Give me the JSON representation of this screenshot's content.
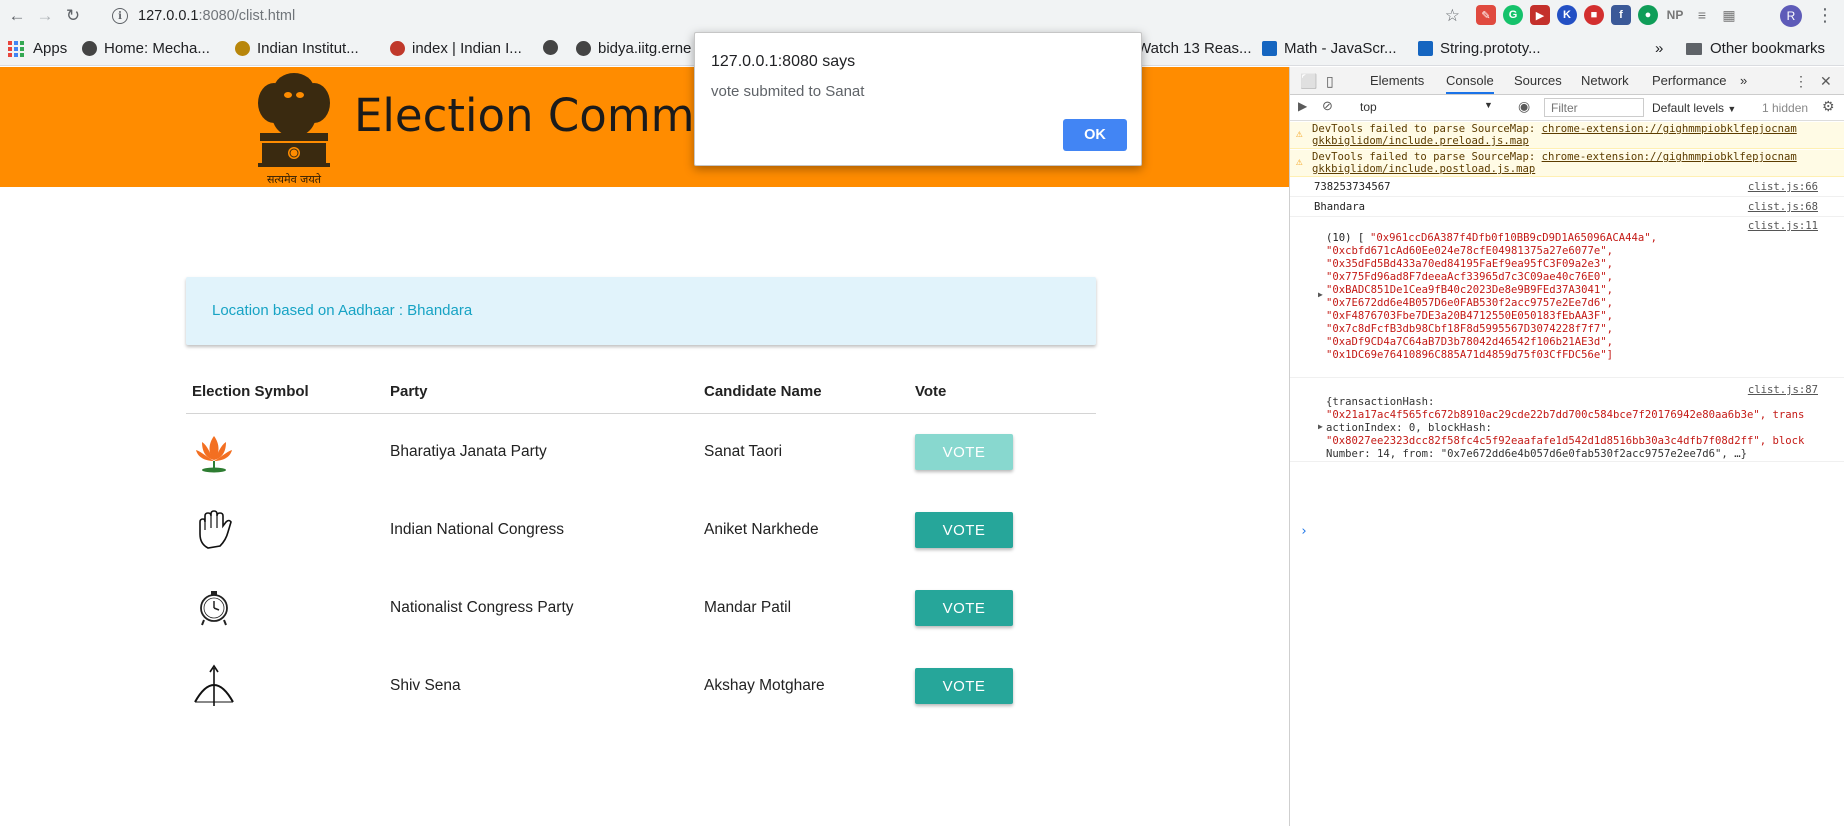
{
  "browser": {
    "url_host": "127.0.0.1",
    "url_path": ":8080/clist.html",
    "profile_initial": "R",
    "extensions": [
      "NP"
    ],
    "bookmarks": [
      {
        "label": "Apps"
      },
      {
        "label": "Home: Mecha..."
      },
      {
        "label": "Indian Institut..."
      },
      {
        "label": "index | Indian I..."
      },
      {
        "label": "bidya.iitg.erne"
      },
      {
        "label": "Watch 13 Reas..."
      },
      {
        "label": "Math - JavaScr..."
      },
      {
        "label": "String.prototy..."
      }
    ],
    "overflow_label": "»",
    "other_bookmarks": "Other bookmarks"
  },
  "header": {
    "title": "Election Commission of India",
    "motto": "सत्यमेव जयते"
  },
  "location": {
    "text": "Location based on Aadhaar : Bhandara"
  },
  "table": {
    "headers": [
      "Election Symbol",
      "Party",
      "Candidate Name",
      "Vote"
    ],
    "rows": [
      {
        "symbol": "lotus-icon",
        "party": "Bharatiya Janata Party",
        "candidate": "Sanat Taori",
        "vote": "VOTE"
      },
      {
        "symbol": "hand-icon",
        "party": "Indian National Congress",
        "candidate": "Aniket Narkhede",
        "vote": "VOTE"
      },
      {
        "symbol": "clock-icon",
        "party": "Nationalist Congress Party",
        "candidate": "Mandar Patil",
        "vote": "VOTE"
      },
      {
        "symbol": "bow-arrow-icon",
        "party": "Shiv Sena",
        "candidate": "Akshay Motghare",
        "vote": "VOTE"
      }
    ]
  },
  "alert": {
    "title": "127.0.0.1:8080 says",
    "message": "vote submited to Sanat",
    "ok": "OK"
  },
  "devtools": {
    "tabs": [
      "Elements",
      "Console",
      "Sources",
      "Network",
      "Performance"
    ],
    "more": "»",
    "context": "top",
    "filter_placeholder": "Filter",
    "levels": "Default levels",
    "hidden": "1 hidden",
    "warnings": [
      {
        "text": "DevTools failed to parse SourceMap: ",
        "link1": "chrome-extension://gighmmpiobklfepjocnam",
        "link2": "gkkbiglidom/include.preload.js.map"
      },
      {
        "text": "DevTools failed to parse SourceMap: ",
        "link1": "chrome-extension://gighmmpiobklfepjocnam",
        "link2": "gkkbiglidom/include.postload.js.map"
      }
    ],
    "logs": [
      {
        "text": "738253734567",
        "src": "clist.js:66"
      },
      {
        "text": "Bhandara",
        "src": "clist.js:68"
      }
    ],
    "array_log": {
      "src": "clist.js:11",
      "prefix": "(10) [",
      "items": [
        "\"0x961ccD6A387f4Dfb0f10BB9cD9D1A65096ACA44a\",",
        "\"0xcbfd671cAd60Ee024e78cfE04981375a27e6077e\",",
        "\"0x35dFd5Bd433a70ed84195FaEf9ea95fC3F09a2e3\",",
        "\"0x775Fd96ad8F7deeaAcf33965d7c3C09ae40c76E0\",",
        "\"0xBADC851De1Cea9fB40c2023De8e9B9FEd37A3041\",",
        "\"0x7E672dd6e4B057D6e0FAB530f2acc9757e2Ee7d6\",",
        "\"0xF4876703Fbe7DE3a20B4712550E050183fEbAA3F\",",
        "\"0x7c8dFcfB3db98Cbf18F8d5995567D3074228f7f7\",",
        "\"0xaDf9CD4a7C64aB7D3b78042d46542f106b21AE3d\",",
        "\"0x1DC69e76410896C885A71d4859d75f03CfFDC56e\"]"
      ]
    },
    "object_log": {
      "src": "clist.js:87",
      "line1": "{transactionHash:",
      "line2": "\"0x21a17ac4f565fc672b8910ac29cde22b7dd700c584bce7f20176942e80aa6b3e\", trans",
      "line3": "actionIndex: 0, blockHash:",
      "line4": "\"0x8027ee2323dcc82f58fc4c5f92eaafafe1d542d1d8516bb30a3c4dfb7f08d2ff\", block",
      "line5": "Number: 14, from: \"0x7e672dd6e4b057d6e0fab530f2acc9757e2ee7d6\", …}"
    },
    "prompt": "›"
  },
  "colors": {
    "header_bg": "#ff8c00",
    "vote_button": "#26a69a",
    "vote_button_active": "#88d8cf",
    "location_bg": "#e1f3fb",
    "location_text": "#17a3c4",
    "alert_ok": "#4285f4"
  }
}
